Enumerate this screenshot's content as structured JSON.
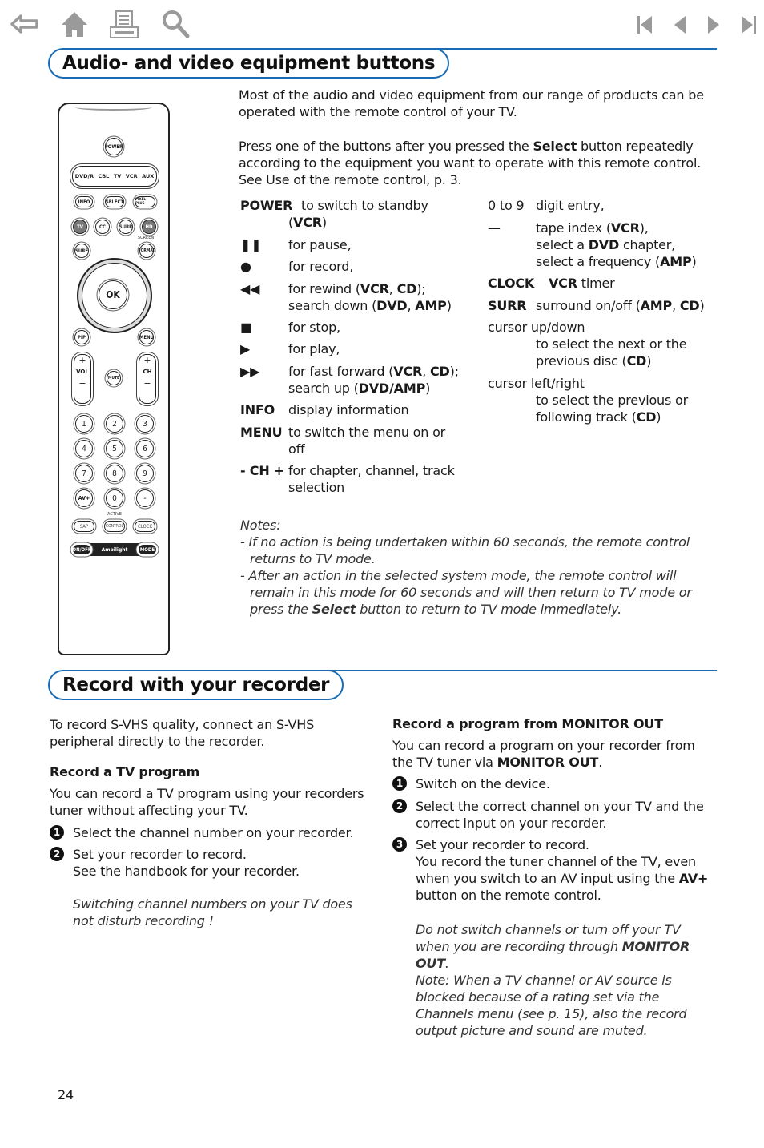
{
  "nav": {
    "left_icons": [
      "back-icon",
      "home-icon",
      "print-icon",
      "search-icon"
    ],
    "right_icons": [
      "first-page-icon",
      "previous-page-icon",
      "next-page-icon",
      "last-page-icon"
    ],
    "icon_color": "#9a9a9a",
    "accent_color": "#1a6bb5"
  },
  "section1": {
    "title": "Audio- and video equipment buttons",
    "intro": "Most of the audio and video equipment from our range of products can be operated with the remote control of your TV.",
    "press_pre": "Press one of the buttons after you pressed the ",
    "press_bold": "Select",
    "press_post": " button repeatedly according to the equipment you want to operate with this remote control. See Use of the remote control, p. 3.",
    "left_defs": [
      {
        "key": "POWER",
        "lines": [
          "to switch to standby",
          "(VCR)"
        ]
      },
      {
        "key": "❚❚",
        "lines": [
          "for pause,"
        ]
      },
      {
        "key": "●",
        "lines": [
          "for record,"
        ]
      },
      {
        "key": "◀◀",
        "lines": [
          "for rewind (VCR, CD);",
          "search down (DVD, AMP)"
        ]
      },
      {
        "key": "■",
        "lines": [
          "for stop,"
        ]
      },
      {
        "key": "▶",
        "lines": [
          "for play,"
        ]
      },
      {
        "key": "▶▶",
        "lines": [
          "for fast forward (VCR, CD);",
          "search up (DVD/AMP)"
        ]
      },
      {
        "key": "INFO",
        "lines": [
          "display information"
        ]
      },
      {
        "key": "MENU",
        "lines": [
          "to switch the menu on or",
          "off"
        ]
      },
      {
        "key": "- CH +",
        "lines": [
          "for chapter, channel, track",
          "selection"
        ]
      }
    ],
    "right_defs": [
      {
        "key": "0 to 9",
        "lines": [
          "digit entry,"
        ]
      },
      {
        "key": "—",
        "lines": [
          "tape index (VCR),",
          "select a DVD chapter,",
          "select a frequency (AMP)"
        ]
      },
      {
        "key": "CLOCK",
        "lines": [
          "VCR timer"
        ]
      },
      {
        "key": "SURR",
        "lines": [
          "surround on/off (AMP, CD)"
        ]
      },
      {
        "key": "cursor up/down",
        "lines": [
          "to select the next or the",
          "previous disc (CD)"
        ]
      },
      {
        "key": "cursor left/right",
        "lines": [
          "to select the previous or",
          "following track (CD)"
        ]
      }
    ],
    "notes_title": "Notes:",
    "note1": "If no action is being undertaken within 60 seconds, the remote control returns to TV mode.",
    "note2_pre": "After an action in the selected system mode, the remote control will remain in this mode for 60 seconds and will then return to TV mode or press the ",
    "note2_bold": "Select",
    "note2_post": " button to return to TV mode immediately."
  },
  "remote": {
    "power": "POWER",
    "modes": [
      "DVD/R",
      "CBL",
      "TV",
      "VCR",
      "AUX"
    ],
    "row1": [
      "INFO",
      "SELECT",
      "PIXEL PLUS"
    ],
    "row2": [
      "TV",
      "CC",
      "SURR",
      "HD"
    ],
    "row3": [
      "SURF",
      "FORMAT"
    ],
    "screen_label": "SCREEN",
    "ok": "OK",
    "pip": "PIP",
    "menu": "MENU",
    "vol": "VOL",
    "mute": "MUTE",
    "ch": "CH",
    "plus": "+",
    "minus": "−",
    "digits": [
      "1",
      "2",
      "3",
      "4",
      "5",
      "6",
      "7",
      "8",
      "9",
      "AV+",
      "0",
      "-"
    ],
    "active_label": "ACTIVE",
    "row_bottom": [
      "SAP",
      "CONTROL",
      "CLOCK"
    ],
    "ambilight": [
      "ON/OFF",
      "Ambilight",
      "MODE"
    ]
  },
  "section2": {
    "title": "Record with your recorder",
    "intro": "To record S-VHS quality, connect an S-VHS peripheral directly to the recorder.",
    "tv_title": "Record a TV program",
    "tv_body": "You can record a TV program using your recorders tuner without affecting your TV.",
    "tv_steps": [
      {
        "n": "1",
        "text": "Select the channel number on your recorder."
      },
      {
        "n": "2",
        "text": "Set your recorder to record.\nSee the handbook for your recorder."
      }
    ],
    "tv_note": "Switching channel numbers on your TV does not disturb recording !",
    "mon_title_pre": "Record a program from ",
    "mon_title_bold": "MONITOR OUT",
    "mon_body_pre": "You can record a program on your recorder from the TV tuner via ",
    "mon_body_bold": "MONITOR OUT",
    "mon_body_post": ".",
    "mon_steps": [
      {
        "n": "1",
        "text": "Switch on the device."
      },
      {
        "n": "2",
        "text": "Select the correct channel on your TV and the correct input on your recorder."
      },
      {
        "n": "3",
        "text": "Set your recorder to record.",
        "extra_pre": "You record the tuner channel of the TV, even when you switch to an AV input using the ",
        "extra_bold": "AV+",
        "extra_post": " button on the remote control."
      }
    ],
    "mon_note1_pre": "Do not switch channels or turn off your TV when you are recording through ",
    "mon_note1_bold": "MONITOR OUT",
    "mon_note1_post": ".",
    "mon_note2": "Note: When a TV channel or AV source is blocked because of a rating set via the Channels menu (see p. 15), also the record output picture and sound are muted."
  },
  "page_number": "24"
}
